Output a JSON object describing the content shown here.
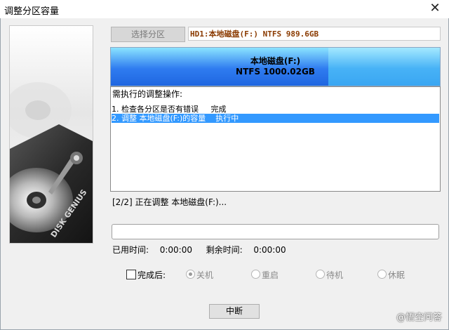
{
  "window": {
    "title": "调整分区容量",
    "close_glyph": "✕"
  },
  "left_panel": {
    "brand_text": "DISK GENIUS",
    "icon": "hard-disk-icon"
  },
  "toolbar": {
    "select_partition_label": "选择分区",
    "disk_info": "HD1:本地磁盘(F:) NTFS 989.6GB"
  },
  "partition_bar": {
    "name": "本地磁盘(F:)",
    "detail": "NTFS 1000.02GB",
    "new_size_fraction": 0.66
  },
  "operations": {
    "header": "需执行的调整操作:",
    "items": [
      {
        "text": "1. 检查各分区是否有错误     完成",
        "selected": false
      },
      {
        "text": "2. 调整 本地磁盘(F:)的容量    执行中",
        "selected": true
      }
    ]
  },
  "status": {
    "line": "[2/2] 正在调整 本地磁盘(F:)..."
  },
  "progress": {
    "value": 0
  },
  "times": {
    "used_label": "已用时间:",
    "used_value": "0:00:00",
    "remaining_label": "剩余时间:",
    "remaining_value": "0:00:00"
  },
  "after_completion": {
    "label": "完成后:",
    "checked": false,
    "options": [
      {
        "label": "关机",
        "selected": true
      },
      {
        "label": "重启",
        "selected": false
      },
      {
        "label": "待机",
        "selected": false
      },
      {
        "label": "休眠",
        "selected": false
      }
    ]
  },
  "actions": {
    "abort_label": "中断"
  },
  "watermark": {
    "text": "@悟空问答"
  },
  "colors": {
    "selection": "#3399ff",
    "disk_info_text": "#8a3a00",
    "partition_fill_top": "#8ae3ff",
    "partition_fill_bottom": "#1f66e0"
  }
}
